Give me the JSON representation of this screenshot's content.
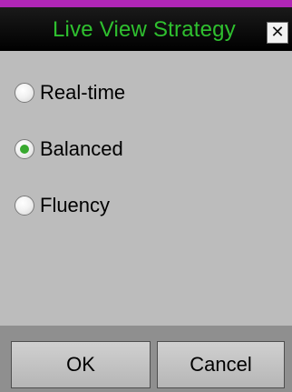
{
  "dialog": {
    "title": "Live View Strategy",
    "close_icon": "close-icon",
    "close_glyph": "✕"
  },
  "options": [
    {
      "label": "Real-time",
      "selected": false
    },
    {
      "label": "Balanced",
      "selected": true
    },
    {
      "label": "Fluency",
      "selected": false
    }
  ],
  "buttons": {
    "ok_label": "OK",
    "cancel_label": "Cancel"
  },
  "colors": {
    "title_text": "#2fc02f",
    "radio_selected": "#38a92f",
    "top_accent": "#b026b6"
  }
}
